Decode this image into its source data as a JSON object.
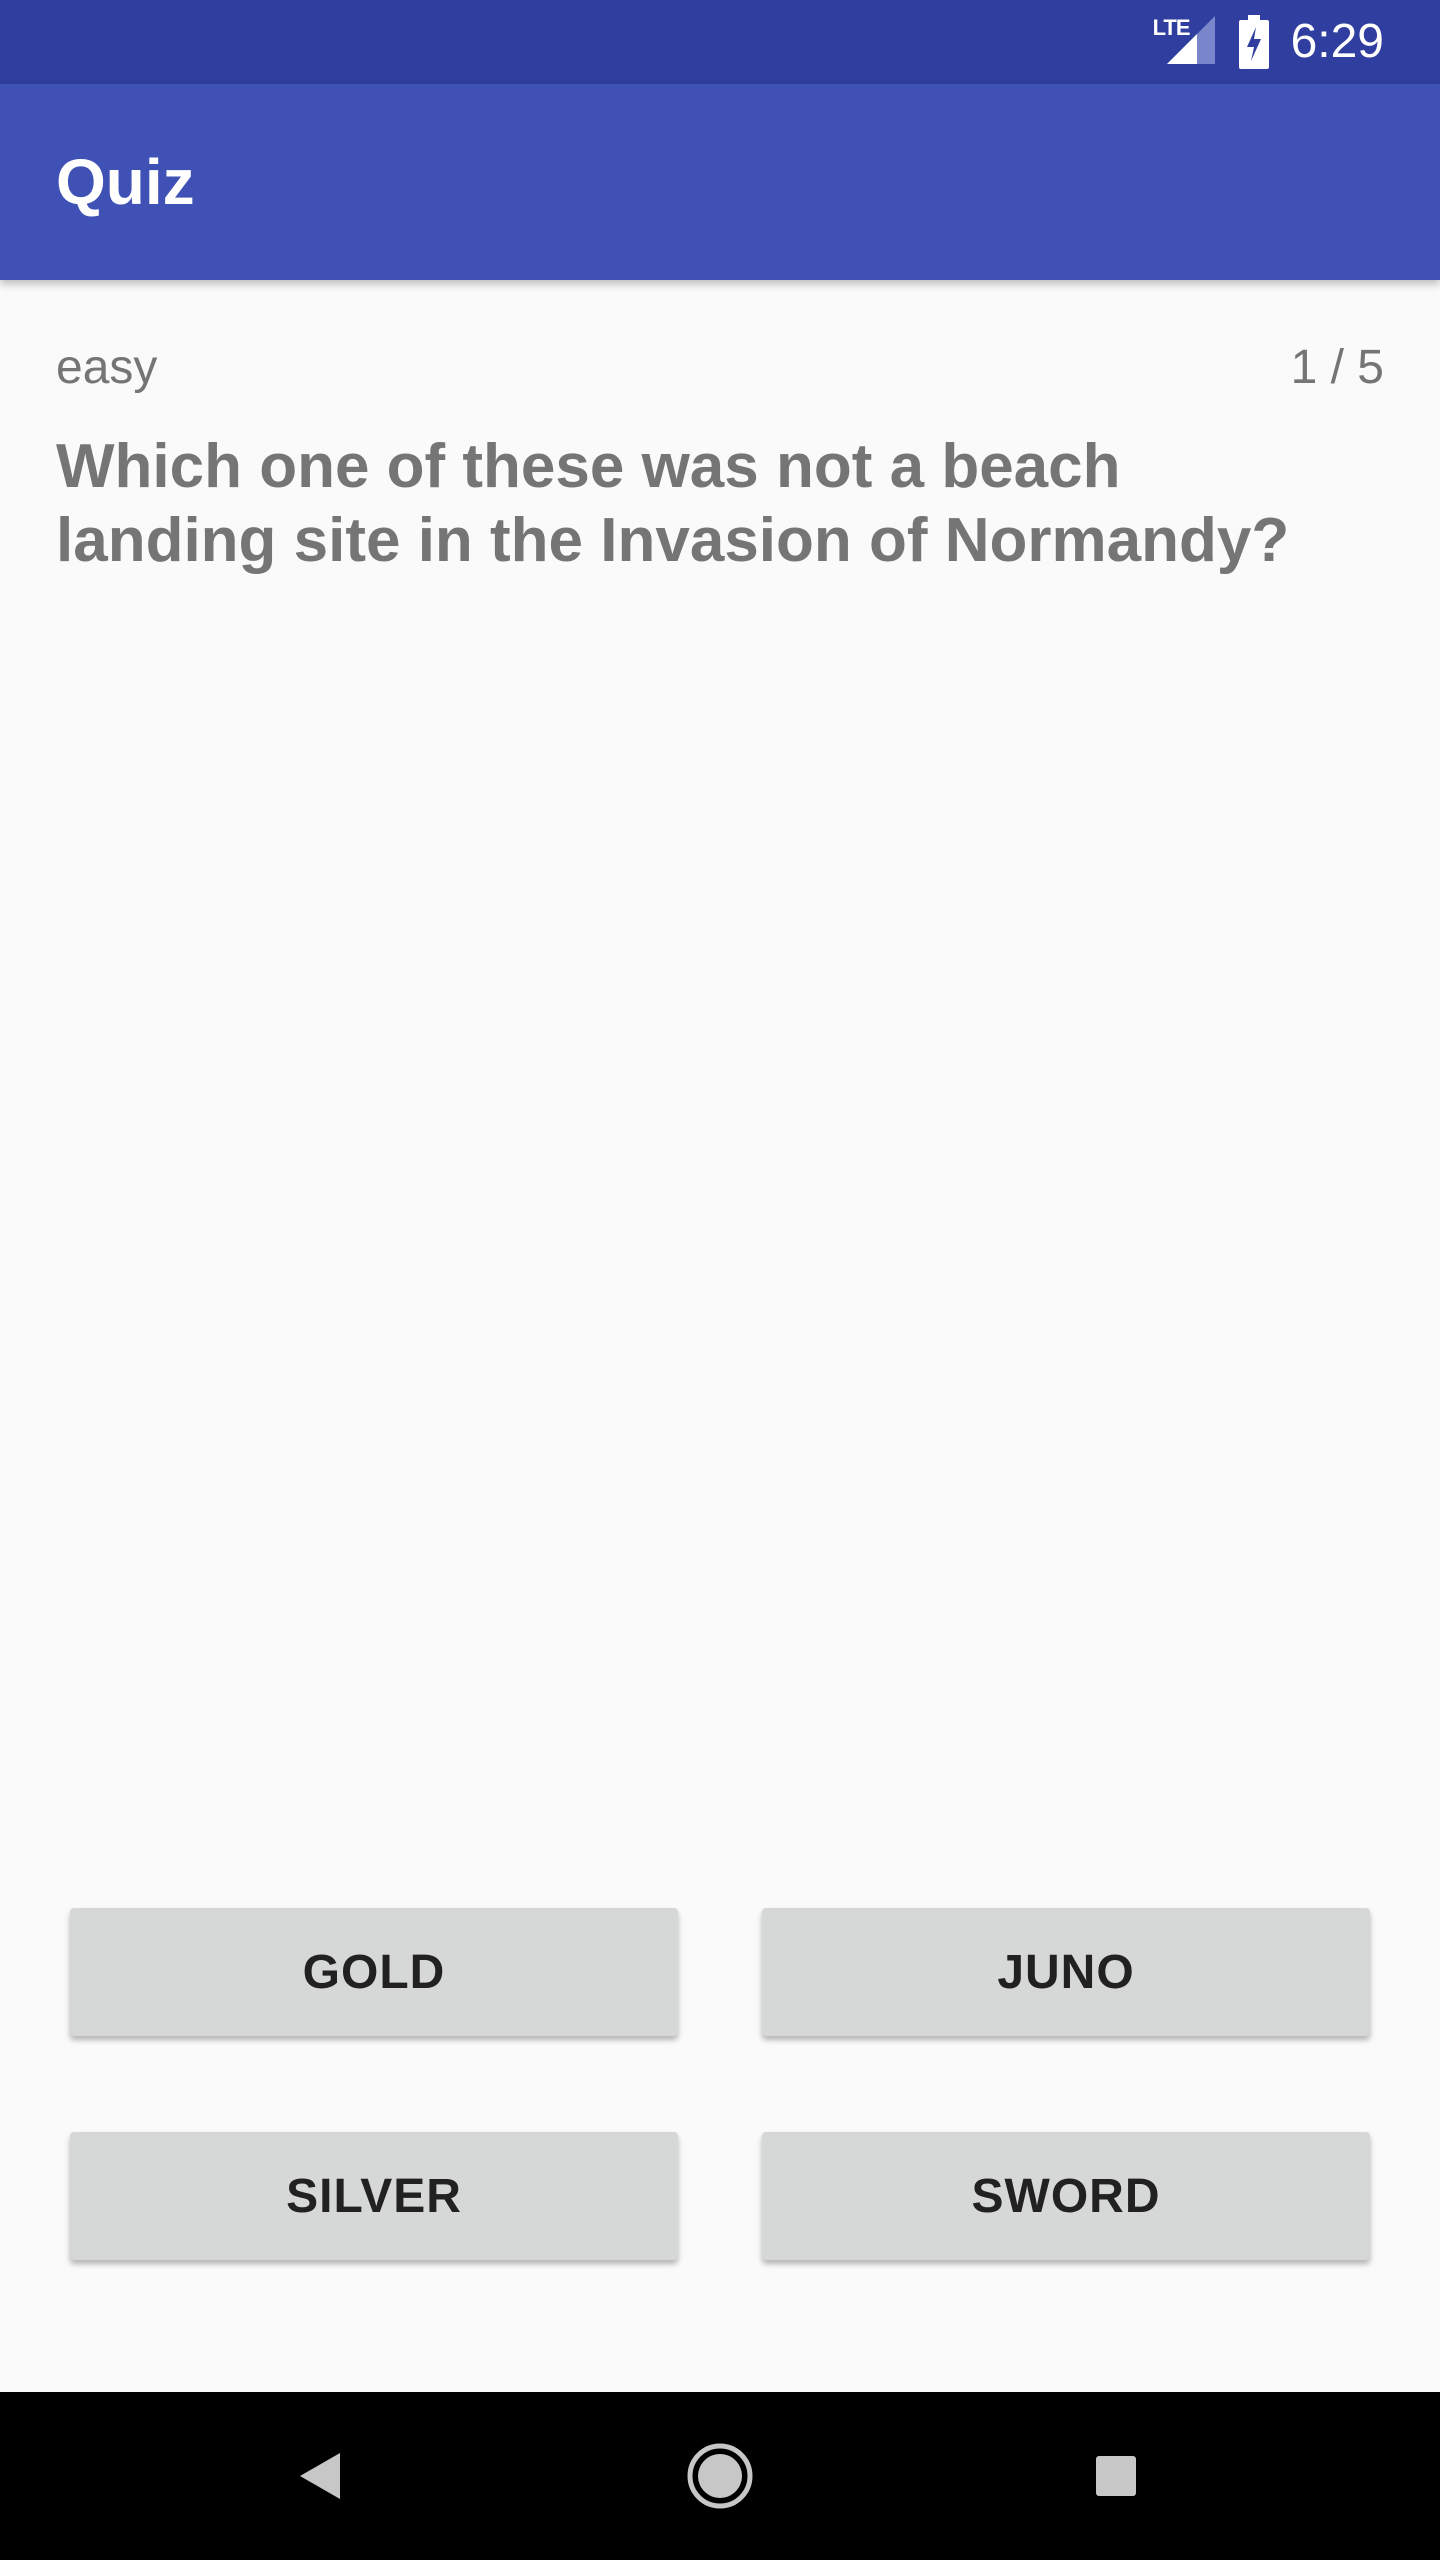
{
  "status_bar": {
    "network": "LTE",
    "time": "6:29"
  },
  "app_bar": {
    "title": "Quiz"
  },
  "quiz": {
    "difficulty": "easy",
    "progress": "1 / 5",
    "question": "Which one of these was not a beach landing site in the Invasion of Normandy?",
    "answers": [
      "GOLD",
      "JUNO",
      "SILVER",
      "SWORD"
    ]
  },
  "colors": {
    "status_bar": "#303f9f",
    "app_bar": "#3f51b5",
    "background": "#fafafa",
    "button": "#d6d7d7"
  },
  "icons": {
    "signal": "cell-signal-icon",
    "battery": "battery-charging-icon",
    "back": "back-triangle-icon",
    "home": "home-circle-icon",
    "recents": "recents-square-icon"
  }
}
